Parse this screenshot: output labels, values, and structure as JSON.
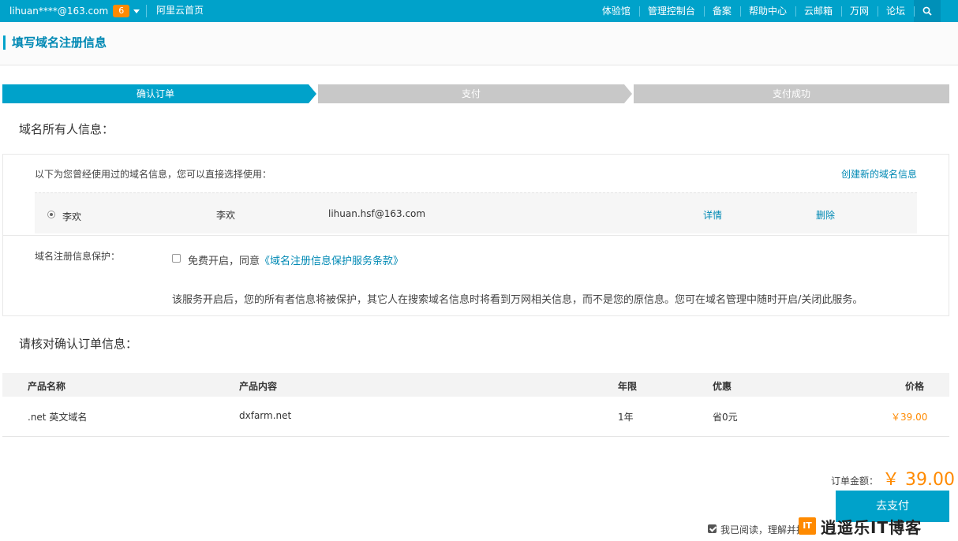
{
  "topbar": {
    "user_email": "lihuan****@163.com",
    "badge_count": "6",
    "home_link": "阿里云首页",
    "nav": [
      "体验馆",
      "管理控制台",
      "备案",
      "帮助中心",
      "云邮箱",
      "万网",
      "论坛"
    ],
    "search_icon": "search-icon"
  },
  "page": {
    "title": "填写域名注册信息"
  },
  "steps": [
    "确认订单",
    "支付",
    "支付成功"
  ],
  "owner": {
    "section_title": "域名所有人信息：",
    "hint": "以下为您曾经使用过的域名信息，您可以直接选择使用：",
    "create_link": "创建新的域名信息",
    "row": {
      "name": "李欢",
      "name2": "李欢",
      "email": "lihuan.hsf@163.com",
      "detail": "详情",
      "delete": "删除"
    }
  },
  "protection": {
    "label": "域名注册信息保护：",
    "text": "免费开启，同意",
    "terms_link": "《域名注册信息保护服务条款》",
    "note": "该服务开启后，您的所有者信息将被保护，其它人在搜索域名信息时将看到万网相关信息，而不是您的原信息。您可在域名管理中随时开启/关闭此服务。"
  },
  "order": {
    "section_title": "请核对确认订单信息：",
    "headers": [
      "产品名称",
      "产品内容",
      "年限",
      "优惠",
      "价格"
    ],
    "rows": [
      {
        "product": ".net 英文域名",
        "content": "dxfarm.net",
        "years": "1年",
        "discount": "省0元",
        "price": "￥39.00"
      }
    ]
  },
  "total": {
    "label": "订单金额：",
    "value": "￥ 39.00"
  },
  "pay_button": "去支付",
  "agree_text": "我已阅读，理解并接",
  "watermark": {
    "logo": "IT",
    "text": "逍遥乐IT博客"
  },
  "colors": {
    "brand": "#00a2ca",
    "accent": "#ff8a00",
    "step_inactive": "#c8c8c8"
  }
}
